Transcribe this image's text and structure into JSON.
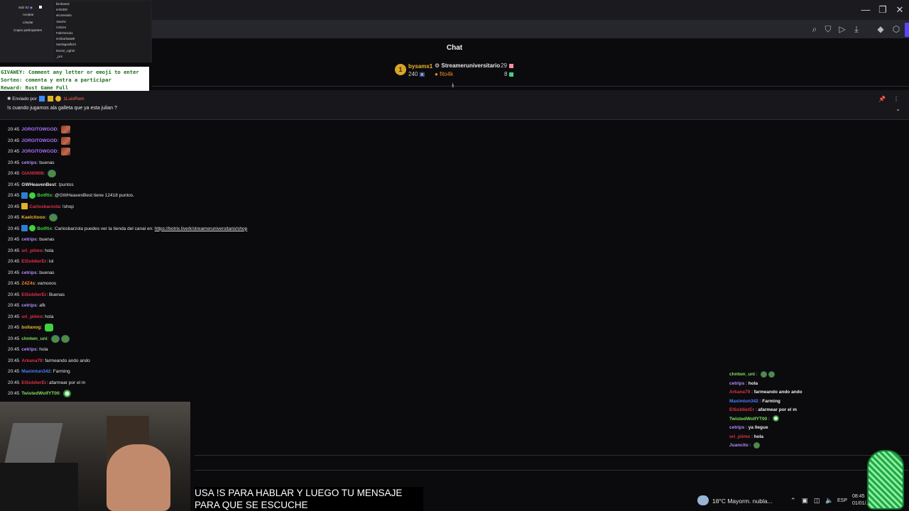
{
  "window": {
    "controls": {
      "minimize": "—",
      "restore": "❐",
      "close": "✕"
    }
  },
  "toolbar_icons": [
    "zoom-icon",
    "shield-icon",
    "play-icon",
    "download-icon",
    "extension-icon",
    "cube-icon"
  ],
  "chat": {
    "title": "Chat",
    "leaderboard": {
      "first": {
        "rank": "1",
        "name": "bysamx1",
        "points": "240"
      },
      "rows": [
        {
          "name": "Streameruniversitario",
          "value": "29"
        },
        {
          "name": "fito4k",
          "value": "8"
        }
      ]
    },
    "pinned": {
      "sent_by_label": "Enviado por",
      "user": "1LuisRem",
      "text": "!s cuando jugamos ala galleta que ya esta julian ?"
    },
    "messages": [
      {
        "time": "20:45",
        "user": "JORGITOWGOD",
        "color": "#a970ff",
        "text": "",
        "emote": "photo"
      },
      {
        "time": "20:45",
        "user": "JORGITOWGOD",
        "color": "#a970ff",
        "text": "",
        "emote": "photo"
      },
      {
        "time": "20:45",
        "user": "JORGITOWGOD",
        "color": "#a970ff",
        "text": "",
        "emote": "photo"
      },
      {
        "time": "20:45",
        "user": "cetrips",
        "color": "#b28cff",
        "text": "buenas"
      },
      {
        "time": "20:45",
        "user": "GIAN0908",
        "color": "#e2304a",
        "text": "",
        "emote": "frog"
      },
      {
        "time": "20:45",
        "user": "GWHeavenBest",
        "color": "#e8e8e8",
        "text": "!puntos"
      },
      {
        "time": "20:45",
        "user": "BotRix",
        "color": "#3fd23f",
        "text": "@GWHeavenBest tiene 12418 puntos.",
        "badges": true
      },
      {
        "time": "20:45",
        "user": "Carlosbarzola",
        "color": "#e2304a",
        "text": "!shop",
        "crown": true
      },
      {
        "time": "20:45",
        "user": "Kaelcitooo",
        "color": "#f0b429",
        "text": "",
        "emote": "frog"
      },
      {
        "time": "20:45",
        "user": "BotRix",
        "color": "#3fd23f",
        "text": "Carlosbarzola puedes ver la tienda del canal en: ",
        "link": "https://botrix.live/k/streameruniversitario/shop",
        "badges": true
      },
      {
        "time": "20:45",
        "user": "cetrips",
        "color": "#b28cff",
        "text": "buenas"
      },
      {
        "time": "20:45",
        "user": "uri_piimo",
        "color": "#e2304a",
        "text": "hola"
      },
      {
        "time": "20:45",
        "user": "ElSoldierEr",
        "color": "#e2304a",
        "text": "lol"
      },
      {
        "time": "20:45",
        "user": "cetrips",
        "color": "#b28cff",
        "text": "buenas"
      },
      {
        "time": "20:45",
        "user": "Z4Z4s",
        "color": "#f0872a",
        "text": "vamooos"
      },
      {
        "time": "20:45",
        "user": "ElSoldierEr",
        "color": "#e2304a",
        "text": "Buenas"
      },
      {
        "time": "20:45",
        "user": "cetrips",
        "color": "#b28cff",
        "text": "afk"
      },
      {
        "time": "20:45",
        "user": "uri_piimo",
        "color": "#e2304a",
        "text": "hola"
      },
      {
        "time": "20:45",
        "user": "bollanog",
        "color": "#f0b429",
        "text": "",
        "emote": "green"
      },
      {
        "time": "20:45",
        "user": "chntwn_uni",
        "color": "#7ee05c",
        "text": "",
        "emote": "frog",
        "emote2": "frog"
      },
      {
        "time": "20:45",
        "user": "cetrips",
        "color": "#b28cff",
        "text": "hola"
      },
      {
        "time": "20:45",
        "user": "Arkana79",
        "color": "#e2304a",
        "text": "farmeando ando ando"
      },
      {
        "time": "20:45",
        "user": "Maximiun342",
        "color": "#4f7dff",
        "text": "Farming"
      },
      {
        "time": "20:45",
        "user": "ElSoldierEr",
        "color": "#e2304a",
        "text": "afarmear por el m"
      },
      {
        "time": "20:45",
        "user": "TwistedWolfYT00",
        "color": "#7ee05c",
        "text": "",
        "emote": "robot"
      }
    ]
  },
  "obs_dock": {
    "labels": [
      "Sub X2",
      "Aceptar",
      "Limpiar",
      "Copiar participantes"
    ],
    "participants": [
      "bimbows2",
      "err0r300",
      "elcometarla",
      "18uch2",
      "Cotizeo",
      "Fabrimn1111",
      "emilcarfasa89",
      "Santiagoalfa10",
      "Doctor_LightX",
      "_pcs"
    ]
  },
  "giveaway": {
    "line1": "GIVAWEY: Comment any letter or emoji to enter",
    "line2": "Sorteo: comenta y entra a participar",
    "line3": "Reward: Rust Game Full"
  },
  "caption": {
    "line1": "USA !S PARA HABLAR Y LUEGO TU MENSAJE",
    "line2": "PARA QUE SE ESCUCHE"
  },
  "overlay_chat": [
    {
      "user": "chntwn_uni",
      "color": "#7ee05c",
      "text": "",
      "emote": "frog",
      "emote2": "frog"
    },
    {
      "user": "cetrips",
      "color": "#b28cff",
      "text": "hola"
    },
    {
      "user": "Arkana79",
      "color": "#e2304a",
      "text": "farmeando ando ando"
    },
    {
      "user": "Maximiun342",
      "color": "#4f7dff",
      "text": "Farming"
    },
    {
      "user": "ElSoldierEr",
      "color": "#e2304a",
      "text": "afarmear por el m"
    },
    {
      "user": "TwistedWolfYT00",
      "color": "#7ee05c",
      "text": "",
      "emote": "robot"
    },
    {
      "user": "cetrips",
      "color": "#b28cff",
      "text": "ya llegue"
    },
    {
      "user": "uri_piimo",
      "color": "#e2304a",
      "text": "hola"
    },
    {
      "user": "Juancito",
      "color": "#b28cff",
      "text": "",
      "emote": "frog"
    }
  ],
  "taskbar": {
    "weather": "18°C  Mayorm. nubla...",
    "lang": "ESP",
    "time": "08:45",
    "date": "01/01/..."
  }
}
